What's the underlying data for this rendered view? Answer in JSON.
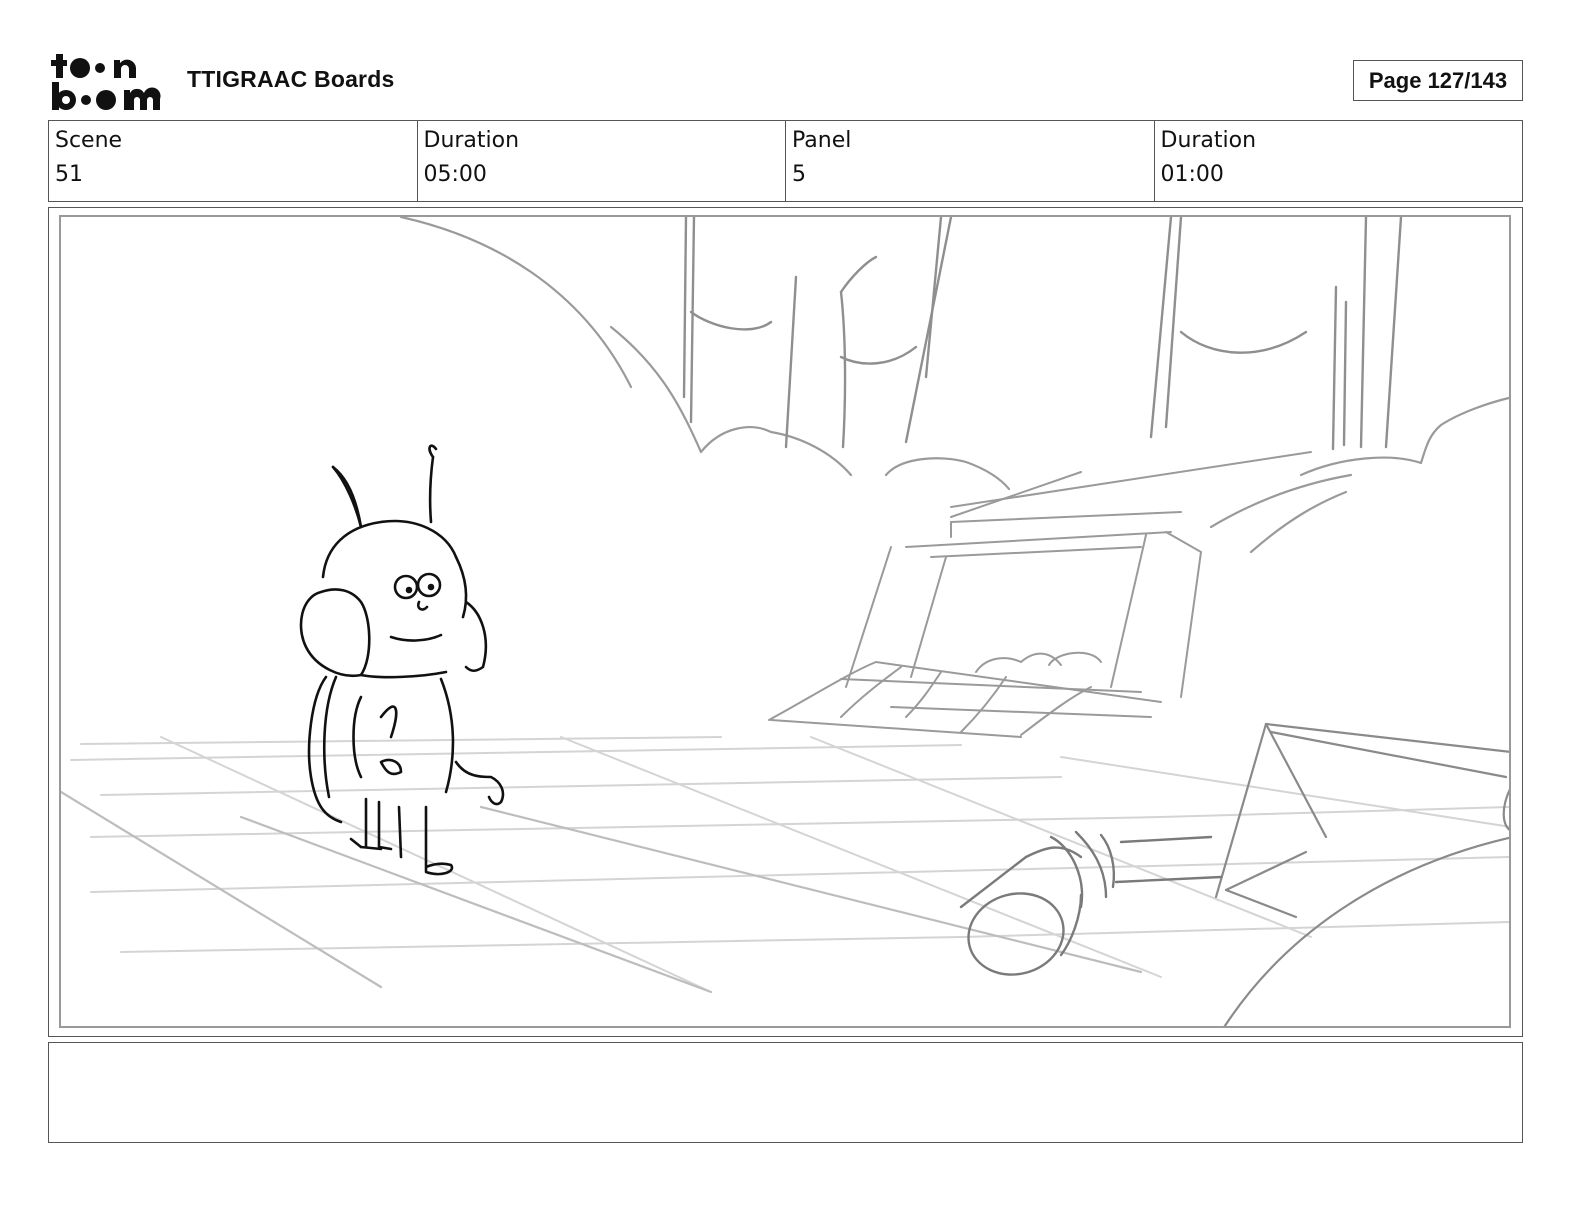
{
  "header": {
    "logo_name": "toon boom logo",
    "title": "TTIGRAAC Boards",
    "page_label": "Page 127/143"
  },
  "info": {
    "scene_label": "Scene",
    "scene_value": "51",
    "scene_duration_label": "Duration",
    "scene_duration_value": "05:00",
    "panel_label": "Panel",
    "panel_value": "5",
    "panel_duration_label": "Duration",
    "panel_duration_value": "01:00"
  },
  "panel": {
    "image_name": "storyboard-sketch"
  },
  "notes": {
    "text": ""
  }
}
